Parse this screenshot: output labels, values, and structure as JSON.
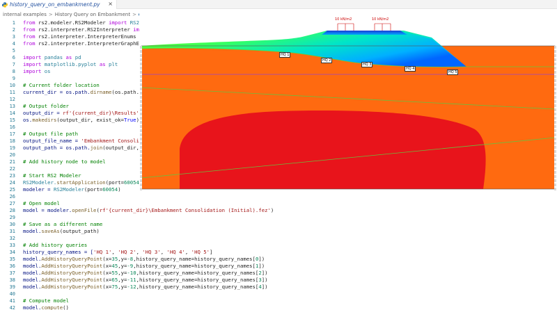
{
  "tab": {
    "label": "history_query_on_embankment.py",
    "close": "×",
    "icon": "python-file-icon"
  },
  "breadcrumb": {
    "items": [
      "internal examples",
      "History Query on Embankment"
    ],
    "file_abbrev": "hi",
    "separator": ">"
  },
  "colors": {
    "line_number": "#237893",
    "keyword": "#0000ff",
    "comment": "#008000",
    "string": "#a31515",
    "function": "#795e26",
    "orange_zone": "#ff6a10",
    "red_zone": "#e8141b",
    "load_blue": "#1a3cd6"
  },
  "code_lines": [
    {
      "n": "1"
    },
    {
      "n": "2"
    },
    {
      "n": "3"
    },
    {
      "n": "4"
    },
    {
      "n": "5"
    },
    {
      "n": "6"
    },
    {
      "n": "7"
    },
    {
      "n": "8"
    },
    {
      "n": "9"
    },
    {
      "n": "10"
    },
    {
      "n": "11"
    },
    {
      "n": "12"
    },
    {
      "n": "13"
    },
    {
      "n": "14"
    },
    {
      "n": "15"
    },
    {
      "n": "16"
    },
    {
      "n": "17"
    },
    {
      "n": "18"
    },
    {
      "n": "19"
    },
    {
      "n": "20"
    },
    {
      "n": "21"
    },
    {
      "n": "22"
    },
    {
      "n": "23"
    },
    {
      "n": "24"
    },
    {
      "n": "25"
    },
    {
      "n": "26"
    },
    {
      "n": "27"
    },
    {
      "n": "28"
    },
    {
      "n": "29"
    },
    {
      "n": "30"
    },
    {
      "n": "31"
    },
    {
      "n": "32"
    },
    {
      "n": "33"
    },
    {
      "n": "34"
    },
    {
      "n": "35"
    },
    {
      "n": "36"
    },
    {
      "n": "37"
    },
    {
      "n": "38"
    },
    {
      "n": "39"
    },
    {
      "n": "40"
    },
    {
      "n": "41"
    },
    {
      "n": "42"
    }
  ],
  "code": {
    "l1": [
      "from ",
      "rs2.modeler.RS2Modeler ",
      "import ",
      "RS2"
    ],
    "l2": [
      "from ",
      "rs2.interpreter.RS2Interpreter ",
      "im"
    ],
    "l3": [
      "from ",
      "rs2.interpreter.InterpreterEnums"
    ],
    "l4": [
      "from ",
      "rs2.interpreter.InterpreterGraphE"
    ],
    "l6": [
      "import ",
      "pandas ",
      "as ",
      "pd"
    ],
    "l7": [
      "import ",
      "matplotlib.pyplot ",
      "as ",
      "plt"
    ],
    "l8": [
      "import ",
      "os"
    ],
    "l10": "# Current folder location",
    "l11": [
      "current_dir = os.path.",
      "dirname",
      "(os.path."
    ],
    "l13": "# Output folder",
    "l14": [
      "output_dir = ",
      "rf'{current_dir}\\Results'"
    ],
    "l15": [
      "os.",
      "makedirs",
      "(output_dir, exist_ok=",
      "True",
      ")"
    ],
    "l17": "# Output file path",
    "l18": [
      "output_file_name = ",
      "'Embankment Consoli"
    ],
    "l19": [
      "output_path = os.path.",
      "join",
      "(output_dir,"
    ],
    "l21": "# Add history node to model",
    "l23": "# Start RS2 Modeler",
    "l24": [
      "RS2Modeler.",
      "startApplication",
      "(port=",
      "60054"
    ],
    "l25": [
      "modeler = ",
      "RS2Modeler",
      "(port=",
      "60054",
      ")"
    ],
    "l27": "# Open model",
    "l28": [
      "model = modeler.",
      "openFile",
      "(",
      "rf'{current_dir}\\Embankment Consolidation (Initial).fez'",
      ")"
    ],
    "l30": "# Save as a different name",
    "l31": [
      "model.",
      "saveAs",
      "(output_path)"
    ],
    "l33": "# Add history queries",
    "l34": [
      "history_query_names = [",
      "'HQ 1'",
      ", ",
      "'HQ 2'",
      ", ",
      "'HQ 3'",
      ", ",
      "'HQ 4'",
      ", ",
      "'HQ 5'",
      "]"
    ],
    "hq_calls": [
      {
        "pre": "model.",
        "fn": "AddHistoryQueryPoint",
        "a": "(x=",
        "x": "35",
        "b": ",y=",
        "y": "-8",
        "c": ",history_query_name=history_query_names[",
        "i": "0",
        "d": "])"
      },
      {
        "pre": "model.",
        "fn": "AddHistoryQueryPoint",
        "a": "(x=",
        "x": "45",
        "b": ",y=",
        "y": "-9",
        "c": ",history_query_name=history_query_names[",
        "i": "1",
        "d": "])"
      },
      {
        "pre": "model.",
        "fn": "AddHistoryQueryPoint",
        "a": "(x=",
        "x": "55",
        "b": ",y=",
        "y": "-10",
        "c": ",history_query_name=history_query_names[",
        "i": "2",
        "d": "])"
      },
      {
        "pre": "model.",
        "fn": "AddHistoryQueryPoint",
        "a": "(x=",
        "x": "65",
        "b": ",y=",
        "y": "-11",
        "c": ",history_query_name=history_query_names[",
        "i": "3",
        "d": "])"
      },
      {
        "pre": "model.",
        "fn": "AddHistoryQueryPoint",
        "a": "(x=",
        "x": "75",
        "b": ",y=",
        "y": "-12",
        "c": ",history_query_name=history_query_names[",
        "i": "4",
        "d": "])"
      }
    ],
    "l41": "# Compute model",
    "l42": [
      "model.",
      "compute",
      "()"
    ]
  },
  "model_view": {
    "load_labels": [
      "10 kN/m2",
      "10 kN/m2"
    ],
    "hq_labels": [
      "HQ 1",
      "HQ 2",
      "HQ 3",
      "HQ 4",
      "HQ 5"
    ]
  }
}
